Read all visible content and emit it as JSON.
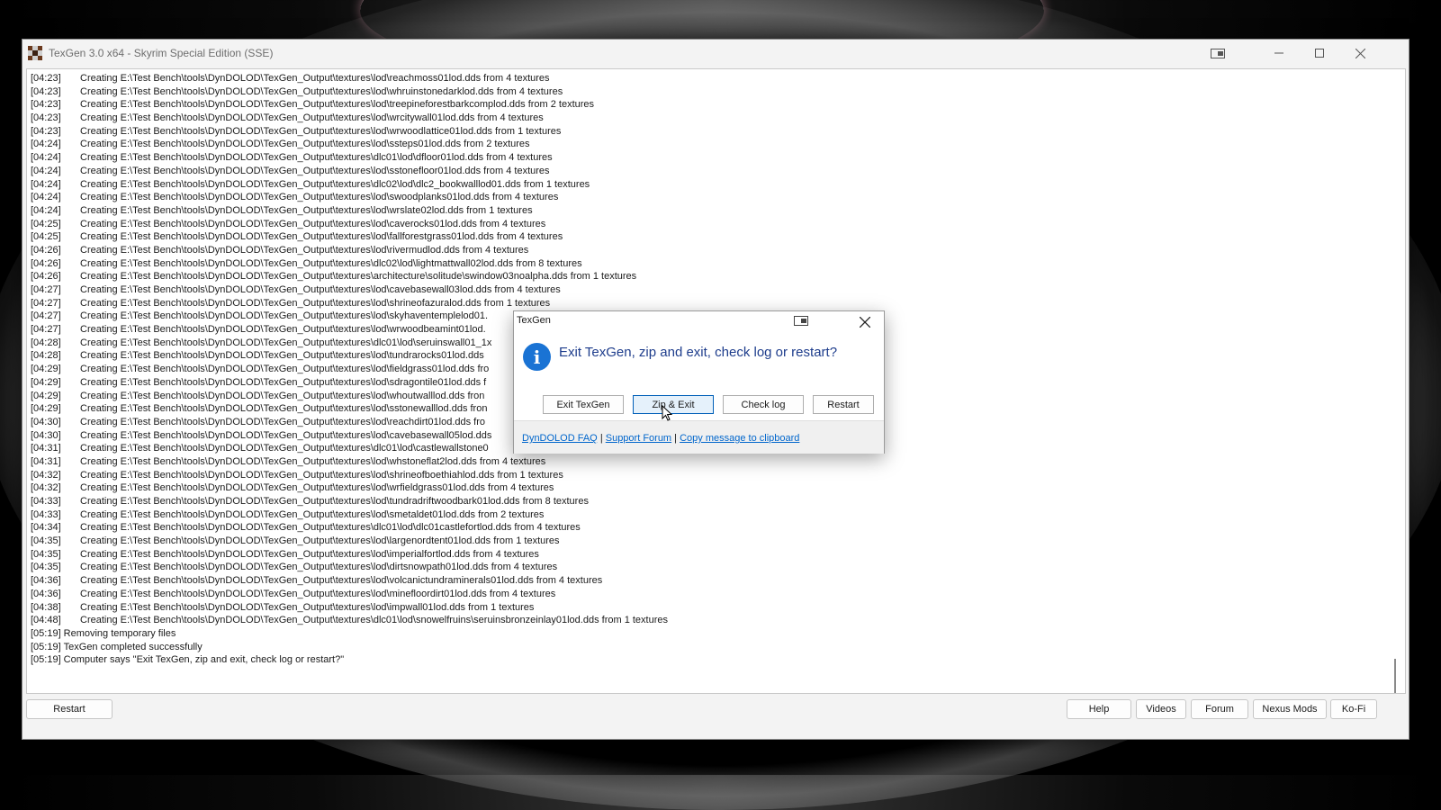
{
  "window": {
    "title": "TexGen 3.0 x64 - Skyrim Special Edition (SSE)"
  },
  "log": {
    "entries": [
      {
        "time": "[04:23]",
        "text": "Creating E:\\Test Bench\\tools\\DynDOLOD\\TexGen_Output\\textures\\lod\\reachmoss01lod.dds from 4 textures"
      },
      {
        "time": "[04:23]",
        "text": "Creating E:\\Test Bench\\tools\\DynDOLOD\\TexGen_Output\\textures\\lod\\whruinstonedarklod.dds from 4 textures"
      },
      {
        "time": "[04:23]",
        "text": "Creating E:\\Test Bench\\tools\\DynDOLOD\\TexGen_Output\\textures\\lod\\treepineforestbarkcomplod.dds from 2 textures"
      },
      {
        "time": "[04:23]",
        "text": "Creating E:\\Test Bench\\tools\\DynDOLOD\\TexGen_Output\\textures\\lod\\wrcitywall01lod.dds from 4 textures"
      },
      {
        "time": "[04:23]",
        "text": "Creating E:\\Test Bench\\tools\\DynDOLOD\\TexGen_Output\\textures\\lod\\wrwoodlattice01lod.dds from 1 textures"
      },
      {
        "time": "[04:24]",
        "text": "Creating E:\\Test Bench\\tools\\DynDOLOD\\TexGen_Output\\textures\\lod\\ssteps01lod.dds from 2 textures"
      },
      {
        "time": "[04:24]",
        "text": "Creating E:\\Test Bench\\tools\\DynDOLOD\\TexGen_Output\\textures\\dlc01\\lod\\dfloor01lod.dds from 4 textures"
      },
      {
        "time": "[04:24]",
        "text": "Creating E:\\Test Bench\\tools\\DynDOLOD\\TexGen_Output\\textures\\lod\\sstonefloor01lod.dds from 4 textures"
      },
      {
        "time": "[04:24]",
        "text": "Creating E:\\Test Bench\\tools\\DynDOLOD\\TexGen_Output\\textures\\dlc02\\lod\\dlc2_bookwalllod01.dds from 1 textures"
      },
      {
        "time": "[04:24]",
        "text": "Creating E:\\Test Bench\\tools\\DynDOLOD\\TexGen_Output\\textures\\lod\\swoodplanks01lod.dds from 4 textures"
      },
      {
        "time": "[04:24]",
        "text": "Creating E:\\Test Bench\\tools\\DynDOLOD\\TexGen_Output\\textures\\lod\\wrslate02lod.dds from 1 textures"
      },
      {
        "time": "[04:25]",
        "text": "Creating E:\\Test Bench\\tools\\DynDOLOD\\TexGen_Output\\textures\\lod\\caverocks01lod.dds from 4 textures"
      },
      {
        "time": "[04:25]",
        "text": "Creating E:\\Test Bench\\tools\\DynDOLOD\\TexGen_Output\\textures\\lod\\fallforestgrass01lod.dds from 4 textures"
      },
      {
        "time": "[04:26]",
        "text": "Creating E:\\Test Bench\\tools\\DynDOLOD\\TexGen_Output\\textures\\lod\\rivermudlod.dds from 4 textures"
      },
      {
        "time": "[04:26]",
        "text": "Creating E:\\Test Bench\\tools\\DynDOLOD\\TexGen_Output\\textures\\dlc02\\lod\\lightmattwall02lod.dds from 8 textures"
      },
      {
        "time": "[04:26]",
        "text": "Creating E:\\Test Bench\\tools\\DynDOLOD\\TexGen_Output\\textures\\architecture\\solitude\\swindow03noalpha.dds from 1 textures"
      },
      {
        "time": "[04:27]",
        "text": "Creating E:\\Test Bench\\tools\\DynDOLOD\\TexGen_Output\\textures\\lod\\cavebasewall03lod.dds from 4 textures"
      },
      {
        "time": "[04:27]",
        "text": "Creating E:\\Test Bench\\tools\\DynDOLOD\\TexGen_Output\\textures\\lod\\shrineofazuralod.dds from 1 textures"
      },
      {
        "time": "[04:27]",
        "text": "Creating E:\\Test Bench\\tools\\DynDOLOD\\TexGen_Output\\textures\\lod\\skyhaventemplelod01."
      },
      {
        "time": "[04:27]",
        "text": "Creating E:\\Test Bench\\tools\\DynDOLOD\\TexGen_Output\\textures\\lod\\wrwoodbeamint01lod."
      },
      {
        "time": "[04:28]",
        "text": "Creating E:\\Test Bench\\tools\\DynDOLOD\\TexGen_Output\\textures\\dlc01\\lod\\seruinswall01_1x"
      },
      {
        "time": "[04:28]",
        "text": "Creating E:\\Test Bench\\tools\\DynDOLOD\\TexGen_Output\\textures\\lod\\tundrarocks01lod.dds"
      },
      {
        "time": "[04:29]",
        "text": "Creating E:\\Test Bench\\tools\\DynDOLOD\\TexGen_Output\\textures\\lod\\fieldgrass01lod.dds fro"
      },
      {
        "time": "[04:29]",
        "text": "Creating E:\\Test Bench\\tools\\DynDOLOD\\TexGen_Output\\textures\\lod\\sdragontile01lod.dds f"
      },
      {
        "time": "[04:29]",
        "text": "Creating E:\\Test Bench\\tools\\DynDOLOD\\TexGen_Output\\textures\\lod\\whoutwalllod.dds fron"
      },
      {
        "time": "[04:29]",
        "text": "Creating E:\\Test Bench\\tools\\DynDOLOD\\TexGen_Output\\textures\\lod\\sstonewalllod.dds fron"
      },
      {
        "time": "[04:30]",
        "text": "Creating E:\\Test Bench\\tools\\DynDOLOD\\TexGen_Output\\textures\\lod\\reachdirt01lod.dds fro"
      },
      {
        "time": "[04:30]",
        "text": "Creating E:\\Test Bench\\tools\\DynDOLOD\\TexGen_Output\\textures\\lod\\cavebasewall05lod.dds"
      },
      {
        "time": "[04:31]",
        "text": "Creating E:\\Test Bench\\tools\\DynDOLOD\\TexGen_Output\\textures\\dlc01\\lod\\castlewallstone0"
      },
      {
        "time": "[04:31]",
        "text": "Creating E:\\Test Bench\\tools\\DynDOLOD\\TexGen_Output\\textures\\lod\\whstoneflat2lod.dds from 4 textures"
      },
      {
        "time": "[04:32]",
        "text": "Creating E:\\Test Bench\\tools\\DynDOLOD\\TexGen_Output\\textures\\lod\\shrineofboethiahlod.dds from 1 textures"
      },
      {
        "time": "[04:32]",
        "text": "Creating E:\\Test Bench\\tools\\DynDOLOD\\TexGen_Output\\textures\\lod\\wrfieldgrass01lod.dds from 4 textures"
      },
      {
        "time": "[04:33]",
        "text": "Creating E:\\Test Bench\\tools\\DynDOLOD\\TexGen_Output\\textures\\lod\\tundradriftwoodbark01lod.dds from 8 textures"
      },
      {
        "time": "[04:33]",
        "text": "Creating E:\\Test Bench\\tools\\DynDOLOD\\TexGen_Output\\textures\\lod\\smetaldet01lod.dds from 2 textures"
      },
      {
        "time": "[04:34]",
        "text": "Creating E:\\Test Bench\\tools\\DynDOLOD\\TexGen_Output\\textures\\dlc01\\lod\\dlc01castlefortlod.dds from 4 textures"
      },
      {
        "time": "[04:35]",
        "text": "Creating E:\\Test Bench\\tools\\DynDOLOD\\TexGen_Output\\textures\\lod\\largenordtent01lod.dds from 1 textures"
      },
      {
        "time": "[04:35]",
        "text": "Creating E:\\Test Bench\\tools\\DynDOLOD\\TexGen_Output\\textures\\lod\\imperialfortlod.dds from 4 textures"
      },
      {
        "time": "[04:35]",
        "text": "Creating E:\\Test Bench\\tools\\DynDOLOD\\TexGen_Output\\textures\\lod\\dirtsnowpath01lod.dds from 4 textures"
      },
      {
        "time": "[04:36]",
        "text": "Creating E:\\Test Bench\\tools\\DynDOLOD\\TexGen_Output\\textures\\lod\\volcanictundraminerals01lod.dds from 4 textures"
      },
      {
        "time": "[04:36]",
        "text": "Creating E:\\Test Bench\\tools\\DynDOLOD\\TexGen_Output\\textures\\lod\\minefloordirt01lod.dds from 4 textures"
      },
      {
        "time": "[04:38]",
        "text": "Creating E:\\Test Bench\\tools\\DynDOLOD\\TexGen_Output\\textures\\lod\\impwall01lod.dds from 1 textures"
      },
      {
        "time": "[04:48]",
        "text": "Creating E:\\Test Bench\\tools\\DynDOLOD\\TexGen_Output\\textures\\dlc01\\lod\\snowelfruins\\seruinsbronzeinlay01lod.dds from 1 textures"
      }
    ],
    "status_entries": [
      {
        "time": "[05:19]",
        "text": "Removing temporary files"
      },
      {
        "time": "[05:19]",
        "text": "TexGen completed successfully"
      },
      {
        "time": "[05:19]",
        "text": "Computer says \"Exit TexGen, zip and exit, check log or restart?\""
      }
    ]
  },
  "bottom_bar": {
    "restart_label": "Restart",
    "help_label": "Help",
    "videos_label": "Videos",
    "forum_label": "Forum",
    "nexus_label": "Nexus Mods",
    "kofi_label": "Ko-Fi"
  },
  "dialog": {
    "title": "TexGen",
    "message": "Exit TexGen, zip and exit, check log or restart?",
    "buttons": {
      "exit": "Exit TexGen",
      "zip_exit": "Zip & Exit",
      "check_log": "Check log",
      "restart": "Restart"
    },
    "links": {
      "faq": "DynDOLOD FAQ",
      "forum": "Support Forum",
      "copy": "Copy message to clipboard",
      "separator": "|"
    }
  },
  "icons": {
    "app": "texgen-app-icon",
    "dialog_info": "info-icon",
    "pin": "pin-window-icon",
    "minimize": "minimize-icon",
    "maximize": "maximize-icon",
    "close": "close-icon"
  },
  "colors": {
    "accent": "#1a73d4",
    "link": "#0066cc",
    "dialog_message": "#1e3d8c"
  }
}
